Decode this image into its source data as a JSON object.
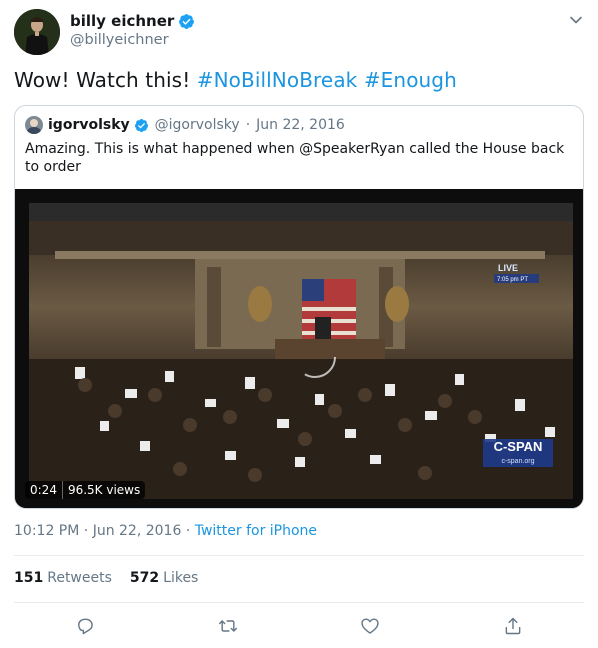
{
  "author": {
    "display_name": "billy eichner",
    "handle": "@billyeichner"
  },
  "tweet": {
    "text_plain": "Wow! Watch this! ",
    "hashtag_1": "#NoBillNoBreak",
    "hashtag_2": "#Enough"
  },
  "quoted": {
    "display_name": "igorvolsky",
    "handle": "@igorvolsky",
    "separator": "·",
    "date": "Jun 22, 2016",
    "text": "Amazing. This is what happened when @SpeakerRyan called the House back to order",
    "video": {
      "duration": "0:24",
      "views": "96.5K views",
      "live_label": "LIVE",
      "live_time": "7:05 pm PT",
      "network_logo": "C-SPAN",
      "network_url": "c-span.org"
    }
  },
  "meta": {
    "time": "10:12 PM",
    "separator_1": "·",
    "date": "Jun 22, 2016",
    "separator_2": "·",
    "source": "Twitter for iPhone"
  },
  "stats": {
    "retweets_count": "151",
    "retweets_label": "Retweets",
    "likes_count": "572",
    "likes_label": "Likes"
  },
  "icons": {
    "verified": "verified-badge-icon",
    "caret": "chevron-down-icon",
    "reply": "reply-icon",
    "retweet": "retweet-icon",
    "like": "heart-icon",
    "share": "share-icon"
  },
  "colors": {
    "link": "#1b95e0",
    "secondary_text": "#657786",
    "border": "#ccd6dd",
    "verified": "#1da1f2"
  }
}
